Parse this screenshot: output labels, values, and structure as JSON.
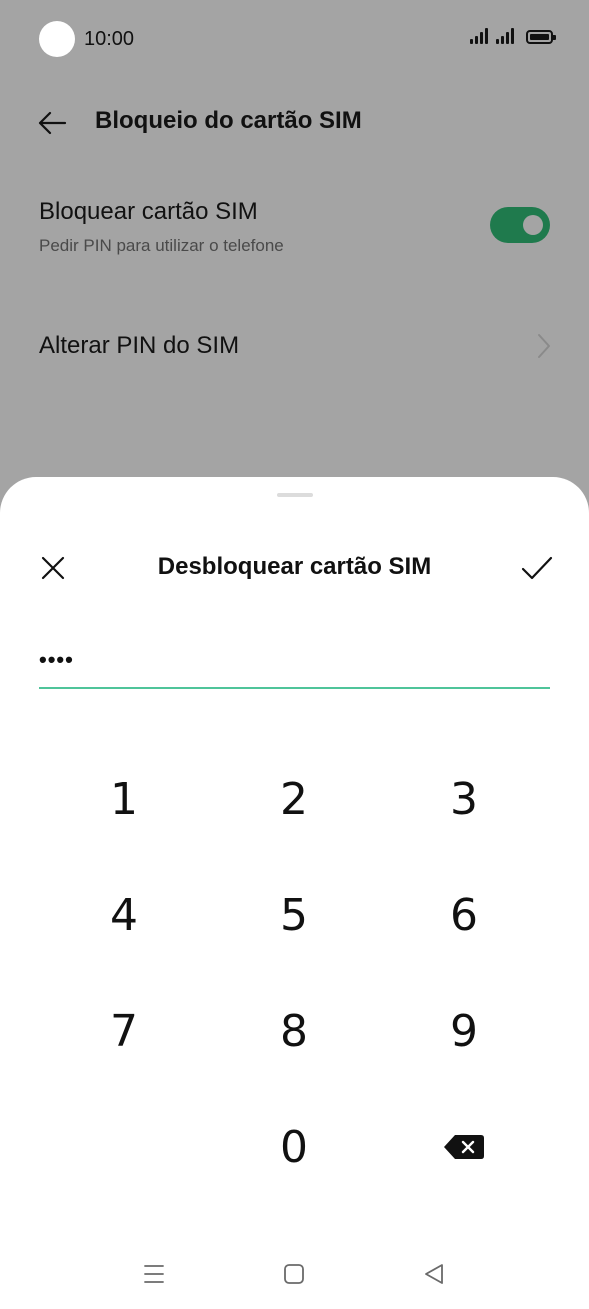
{
  "status_bar": {
    "time": "10:00"
  },
  "header": {
    "title": "Bloqueio do cartão SIM",
    "back_icon": "arrow-left-icon"
  },
  "settings": {
    "lock_sim": {
      "title": "Bloquear cartão SIM",
      "subtitle": "Pedir PIN para utilizar o telefone",
      "enabled": true
    },
    "change_pin": {
      "title": "Alterar PIN do SIM"
    }
  },
  "sheet": {
    "title": "Desbloquear cartão SIM",
    "pin_value": "••••",
    "close_icon": "close-icon",
    "confirm_icon": "checkmark-icon"
  },
  "keypad": {
    "keys": [
      "1",
      "2",
      "3",
      "4",
      "5",
      "6",
      "7",
      "8",
      "9",
      "0"
    ],
    "backspace_icon": "backspace-icon"
  },
  "nav_bar": {
    "icons": [
      "menu-icon",
      "home-icon",
      "back-triangle-icon"
    ]
  },
  "colors": {
    "dim_background": "#a4a4a4",
    "toggle_on": "#1f7a4d",
    "pin_underline": "#4fc49a",
    "sheet_background": "#ffffff"
  }
}
